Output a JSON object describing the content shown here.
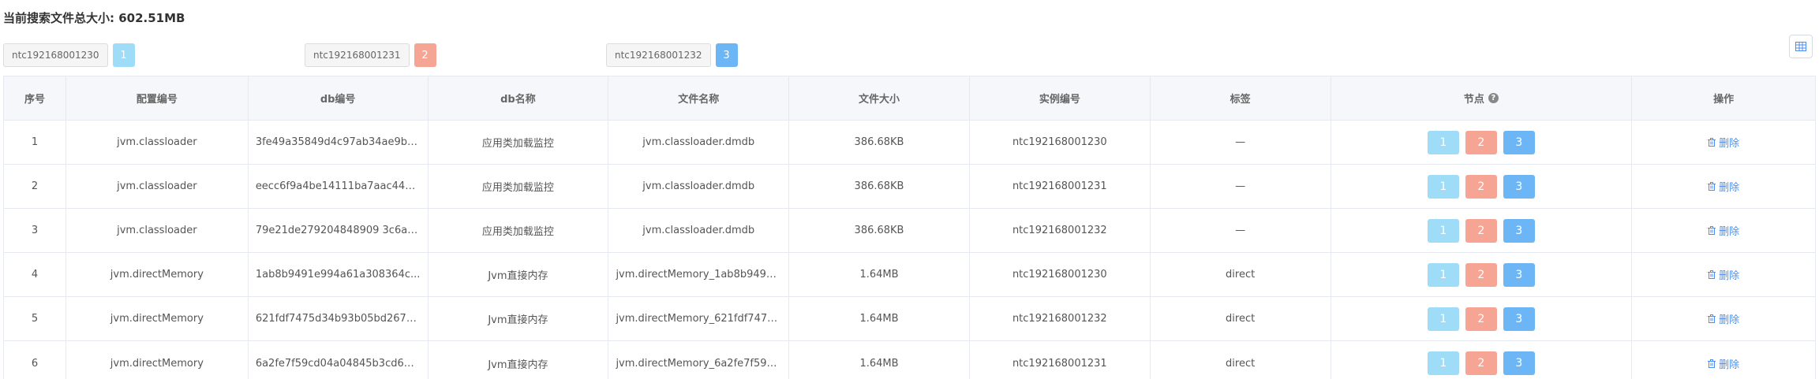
{
  "summary": {
    "label": "当前搜索文件总大小: 602.51MB"
  },
  "colors": {
    "node1": "#9fdcf8",
    "node2": "#f6a595",
    "node3": "#6cb6f5",
    "accent": "#4a8ff0"
  },
  "legend": [
    {
      "host": "ntc192168001230",
      "num": "1"
    },
    {
      "host": "ntc192168001231",
      "num": "2"
    },
    {
      "host": "ntc192168001232",
      "num": "3"
    }
  ],
  "toolbar": {
    "grid_icon": "grid-icon"
  },
  "table": {
    "headers": [
      "序号",
      "配置编号",
      "db编号",
      "db名称",
      "文件名称",
      "文件大小",
      "实例编号",
      "标签",
      "节点",
      "操作"
    ],
    "delete_label": "删除",
    "node_labels": [
      "1",
      "2",
      "3"
    ],
    "rows": [
      {
        "index": "1",
        "config": "jvm.classloader",
        "db_id": "3fe49a35849d4c97ab34ae9b0...",
        "db_name": "应用类加载监控",
        "file_name": "jvm.classloader.dmdb",
        "size": "386.68KB",
        "instance": "ntc192168001230",
        "tag": "—"
      },
      {
        "index": "2",
        "config": "jvm.classloader",
        "db_id": "eecc6f9a4be14111ba7aac44d...",
        "db_name": "应用类加载监控",
        "file_name": "jvm.classloader.dmdb",
        "size": "386.68KB",
        "instance": "ntc192168001231",
        "tag": "—"
      },
      {
        "index": "3",
        "config": "jvm.classloader",
        "db_id": "79e21de279204848909 3c6a2...",
        "db_name": "应用类加载监控",
        "file_name": "jvm.classloader.dmdb",
        "size": "386.68KB",
        "instance": "ntc192168001232",
        "tag": "—"
      },
      {
        "index": "4",
        "config": "jvm.directMemory",
        "db_id": "1ab8b9491e994a61a308364c...",
        "db_name": "Jvm直接内存",
        "file_name": "jvm.directMemory_1ab8b9491...",
        "size": "1.64MB",
        "instance": "ntc192168001230",
        "tag": "direct"
      },
      {
        "index": "5",
        "config": "jvm.directMemory",
        "db_id": "621fdf7475d34b93b05bd267ef...",
        "db_name": "Jvm直接内存",
        "file_name": "jvm.directMemory_621fdf7475...",
        "size": "1.64MB",
        "instance": "ntc192168001232",
        "tag": "direct"
      },
      {
        "index": "6",
        "config": "jvm.directMemory",
        "db_id": "6a2fe7f59cd04a04845b3cd65f...",
        "db_name": "Jvm直接内存",
        "file_name": "jvm.directMemory_6a2fe7f59c...",
        "size": "1.64MB",
        "instance": "ntc192168001231",
        "tag": "direct"
      }
    ]
  }
}
